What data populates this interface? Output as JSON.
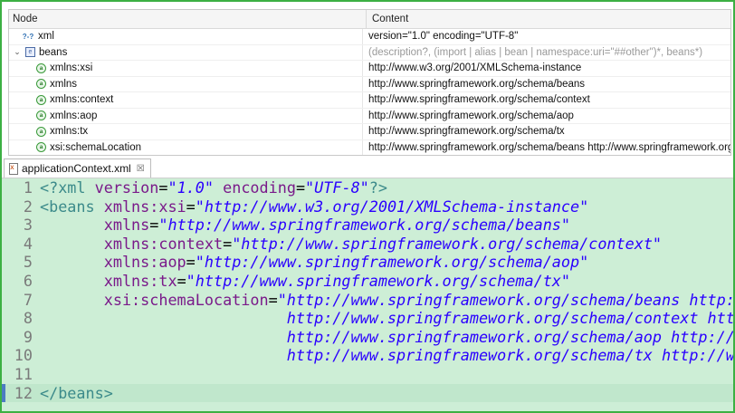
{
  "tree": {
    "columns": [
      "Node",
      "Content"
    ],
    "rows": [
      {
        "icon": "processing-instruction-icon",
        "twisty": "",
        "node": "xml",
        "content": "version=\"1.0\" encoding=\"UTF-8\"",
        "grey": false
      },
      {
        "icon": "element-icon",
        "twisty": "⌄",
        "node": "beans",
        "content": "(description?, (import | alias | bean | namespace:uri=\"##other\")*, beans*)",
        "grey": true
      },
      {
        "icon": "attribute-icon",
        "twisty": "",
        "node": "xmlns:xsi",
        "content": "http://www.w3.org/2001/XMLSchema-instance",
        "grey": false
      },
      {
        "icon": "attribute-icon",
        "twisty": "",
        "node": "xmlns",
        "content": "http://www.springframework.org/schema/beans",
        "grey": false
      },
      {
        "icon": "attribute-icon",
        "twisty": "",
        "node": "xmlns:context",
        "content": "http://www.springframework.org/schema/context",
        "grey": false
      },
      {
        "icon": "attribute-icon",
        "twisty": "",
        "node": "xmlns:aop",
        "content": "http://www.springframework.org/schema/aop",
        "grey": false
      },
      {
        "icon": "attribute-icon",
        "twisty": "",
        "node": "xmlns:tx",
        "content": "http://www.springframework.org/schema/tx",
        "grey": false
      },
      {
        "icon": "attribute-icon",
        "twisty": "",
        "node": "xsi:schemaLocation",
        "content": "http://www.springframework.org/schema/beans http://www.springframework.org",
        "grey": false
      }
    ]
  },
  "editor": {
    "tab_label": "applicationContext.xml",
    "close_glyph": "☒",
    "current_line": 12,
    "lines": [
      [
        [
          "t",
          "<?xml "
        ],
        [
          "a",
          "version"
        ],
        [
          "e",
          "="
        ],
        [
          "v",
          "\"1.0\""
        ],
        [
          "e",
          " "
        ],
        [
          "a",
          "encoding"
        ],
        [
          "e",
          "="
        ],
        [
          "v",
          "\"UTF-8\""
        ],
        [
          "t",
          "?>"
        ]
      ],
      [
        [
          "t",
          "<beans "
        ],
        [
          "a",
          "xmlns:xsi"
        ],
        [
          "e",
          "="
        ],
        [
          "v",
          "\"http://www.w3.org/2001/XMLSchema-instance\""
        ]
      ],
      [
        [
          "e",
          "       "
        ],
        [
          "a",
          "xmlns"
        ],
        [
          "e",
          "="
        ],
        [
          "v",
          "\"http://www.springframework.org/schema/beans\""
        ]
      ],
      [
        [
          "e",
          "       "
        ],
        [
          "a",
          "xmlns:context"
        ],
        [
          "e",
          "="
        ],
        [
          "v",
          "\"http://www.springframework.org/schema/context\""
        ]
      ],
      [
        [
          "e",
          "       "
        ],
        [
          "a",
          "xmlns:aop"
        ],
        [
          "e",
          "="
        ],
        [
          "v",
          "\"http://www.springframework.org/schema/aop\""
        ]
      ],
      [
        [
          "e",
          "       "
        ],
        [
          "a",
          "xmlns:tx"
        ],
        [
          "e",
          "="
        ],
        [
          "v",
          "\"http://www.springframework.org/schema/tx\""
        ]
      ],
      [
        [
          "e",
          "       "
        ],
        [
          "a",
          "xsi:schemaLocation"
        ],
        [
          "e",
          "="
        ],
        [
          "v",
          "\"http://www.springframework.org/schema/beans http://www.springframework.org/schema/beans/spring-beans.xsd"
        ]
      ],
      [
        [
          "v",
          "                           http://www.springframework.org/schema/context http://www.springframework.org/schema/context/spring-context.xsd"
        ]
      ],
      [
        [
          "v",
          "                           http://www.springframework.org/schema/aop http://www.springframework.org/schema/aop/spring-aop.xsd"
        ]
      ],
      [
        [
          "v",
          "                           http://www.springframework.org/schema/tx http://www.springframework.org/schema/tx/spring-tx.xsd\""
        ],
        [
          "t",
          ">"
        ]
      ],
      [],
      [
        [
          "t",
          "</beans>"
        ]
      ]
    ]
  }
}
